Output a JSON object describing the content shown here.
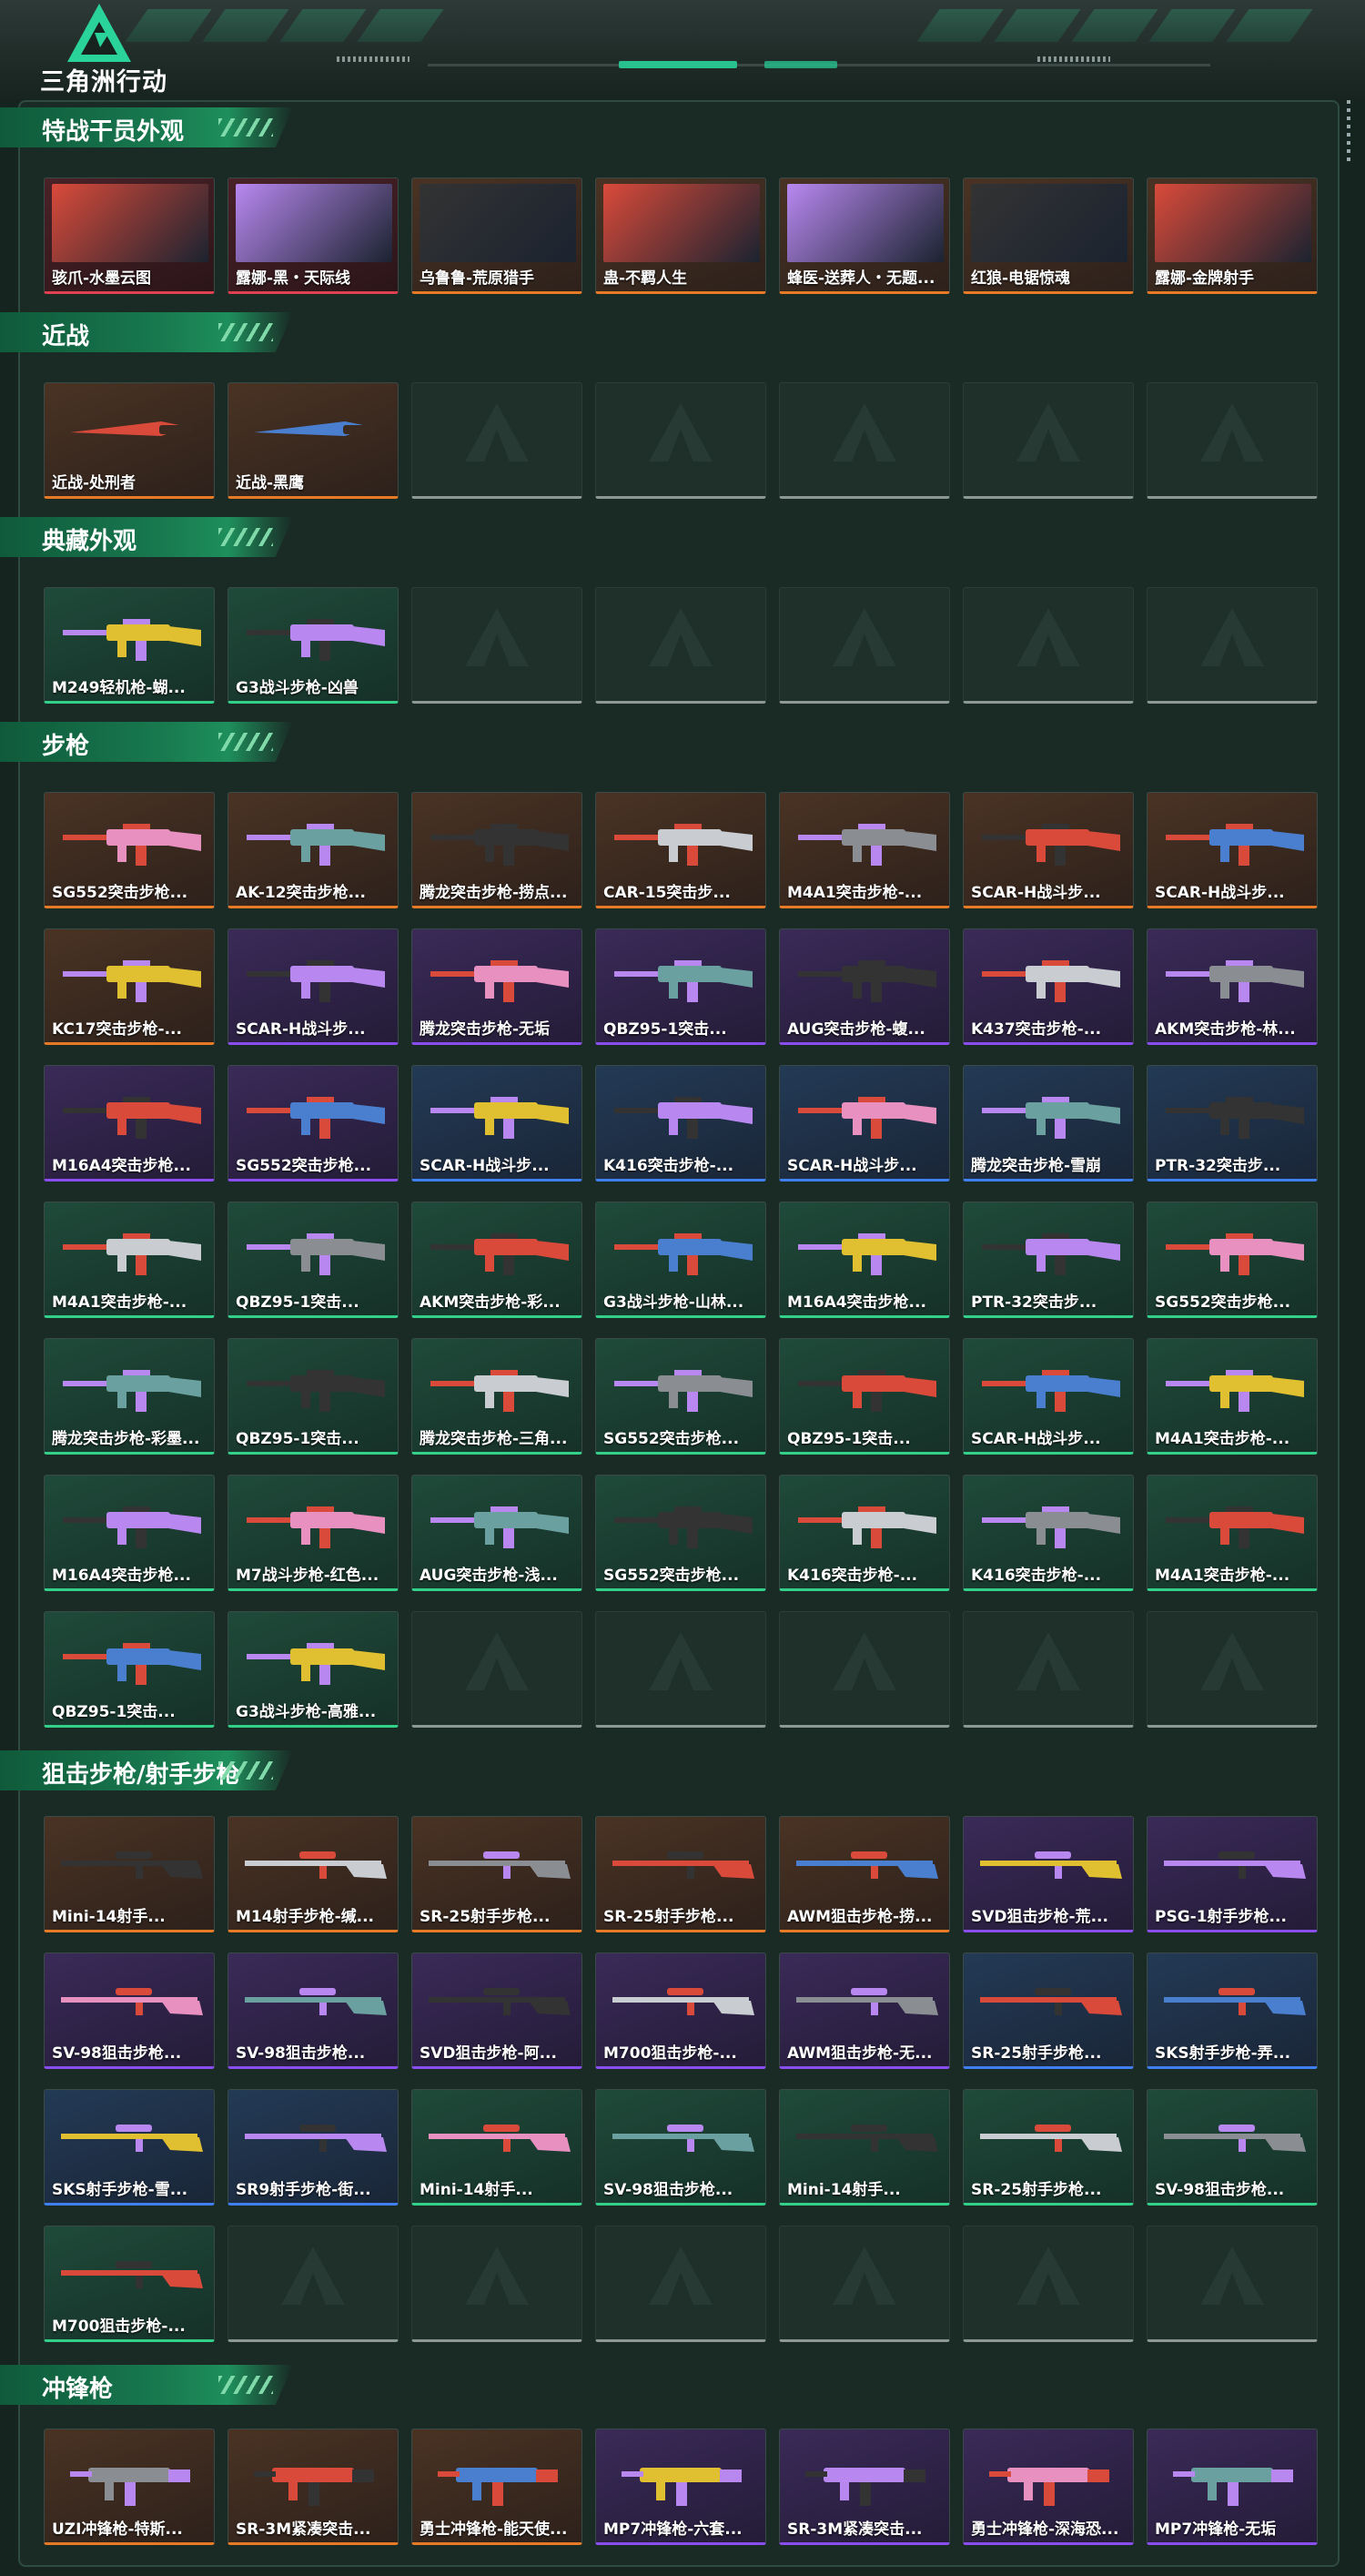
{
  "header": {
    "logo_text": "三角洲行动"
  },
  "colors": {
    "gold": "#e77a24",
    "purple": "#8a4ef0",
    "blue": "#3f7ff0",
    "green": "#33d08a",
    "red": "#e04150",
    "accent": "#27c08e"
  },
  "sections": [
    {
      "title": "特战干员外观",
      "items": [
        {
          "label": "骇爪-水墨云图",
          "rarity": "red",
          "icon": "operator-portrait"
        },
        {
          "label": "露娜-黑・天际线",
          "rarity": "red",
          "icon": "operator-portrait"
        },
        {
          "label": "乌鲁鲁-荒原猎手",
          "rarity": "gold",
          "icon": "operator-portrait"
        },
        {
          "label": "蛊-不羁人生",
          "rarity": "gold",
          "icon": "operator-portrait"
        },
        {
          "label": "蜂医-送葬人・无题...",
          "rarity": "gold",
          "icon": "operator-portrait"
        },
        {
          "label": "红狼-电锯惊魂",
          "rarity": "gold",
          "icon": "operator-portrait"
        },
        {
          "label": "露娜-金牌射手",
          "rarity": "gold",
          "icon": "operator-portrait"
        }
      ]
    },
    {
      "title": "近战",
      "items": [
        {
          "label": "近战-处刑者",
          "rarity": "gold",
          "icon": "blade"
        },
        {
          "label": "近战-黑鹰",
          "rarity": "gold",
          "icon": "knife"
        },
        {
          "empty": true
        },
        {
          "empty": true
        },
        {
          "empty": true
        },
        {
          "empty": true
        },
        {
          "empty": true
        }
      ]
    },
    {
      "title": "典藏外观",
      "items": [
        {
          "label": "M249轻机枪-蝴...",
          "rarity": "green",
          "icon": "lmg"
        },
        {
          "label": "G3战斗步枪-凶兽",
          "rarity": "green",
          "icon": "rifle"
        },
        {
          "empty": true
        },
        {
          "empty": true
        },
        {
          "empty": true
        },
        {
          "empty": true
        },
        {
          "empty": true
        }
      ]
    },
    {
      "title": "步枪",
      "items": [
        {
          "label": "SG552突击步枪...",
          "rarity": "gold",
          "icon": "rifle"
        },
        {
          "label": "AK-12突击步枪...",
          "rarity": "gold",
          "icon": "rifle"
        },
        {
          "label": "腾龙突击步枪-捞点...",
          "rarity": "gold",
          "icon": "rifle"
        },
        {
          "label": "CAR-15突击步...",
          "rarity": "gold",
          "icon": "rifle"
        },
        {
          "label": "M4A1突击步枪-...",
          "rarity": "gold",
          "icon": "rifle"
        },
        {
          "label": "SCAR-H战斗步...",
          "rarity": "gold",
          "icon": "rifle"
        },
        {
          "label": "SCAR-H战斗步...",
          "rarity": "gold",
          "icon": "rifle"
        },
        {
          "label": "KC17突击步枪-...",
          "rarity": "gold",
          "icon": "rifle"
        },
        {
          "label": "SCAR-H战斗步...",
          "rarity": "purple",
          "icon": "rifle"
        },
        {
          "label": "腾龙突击步枪-无垢",
          "rarity": "purple",
          "icon": "rifle"
        },
        {
          "label": "QBZ95-1突击...",
          "rarity": "purple",
          "icon": "rifle"
        },
        {
          "label": "AUG突击步枪-蝮...",
          "rarity": "purple",
          "icon": "rifle"
        },
        {
          "label": "K437突击步枪-...",
          "rarity": "purple",
          "icon": "rifle"
        },
        {
          "label": "AKM突击步枪-林...",
          "rarity": "purple",
          "icon": "rifle"
        },
        {
          "label": "M16A4突击步枪...",
          "rarity": "purple",
          "icon": "rifle"
        },
        {
          "label": "SG552突击步枪...",
          "rarity": "purple",
          "icon": "rifle"
        },
        {
          "label": "SCAR-H战斗步...",
          "rarity": "blue",
          "icon": "rifle"
        },
        {
          "label": "K416突击步枪-...",
          "rarity": "blue",
          "icon": "rifle"
        },
        {
          "label": "SCAR-H战斗步...",
          "rarity": "blue",
          "icon": "rifle"
        },
        {
          "label": "腾龙突击步枪-雪崩",
          "rarity": "blue",
          "icon": "rifle"
        },
        {
          "label": "PTR-32突击步...",
          "rarity": "blue",
          "icon": "rifle"
        },
        {
          "label": "M4A1突击步枪-...",
          "rarity": "green",
          "icon": "rifle"
        },
        {
          "label": "QBZ95-1突击...",
          "rarity": "green",
          "icon": "rifle"
        },
        {
          "label": "AKM突击步枪-彩...",
          "rarity": "green",
          "icon": "rifle"
        },
        {
          "label": "G3战斗步枪-山林...",
          "rarity": "green",
          "icon": "rifle"
        },
        {
          "label": "M16A4突击步枪...",
          "rarity": "green",
          "icon": "rifle"
        },
        {
          "label": "PTR-32突击步...",
          "rarity": "green",
          "icon": "rifle"
        },
        {
          "label": "SG552突击步枪...",
          "rarity": "green",
          "icon": "rifle"
        },
        {
          "label": "腾龙突击步枪-彩墨...",
          "rarity": "green",
          "icon": "rifle"
        },
        {
          "label": "QBZ95-1突击...",
          "rarity": "green",
          "icon": "rifle"
        },
        {
          "label": "腾龙突击步枪-三角...",
          "rarity": "green",
          "icon": "rifle"
        },
        {
          "label": "SG552突击步枪...",
          "rarity": "green",
          "icon": "rifle"
        },
        {
          "label": "QBZ95-1突击...",
          "rarity": "green",
          "icon": "rifle"
        },
        {
          "label": "SCAR-H战斗步...",
          "rarity": "green",
          "icon": "rifle"
        },
        {
          "label": "M4A1突击步枪-...",
          "rarity": "green",
          "icon": "rifle"
        },
        {
          "label": "M16A4突击步枪...",
          "rarity": "green",
          "icon": "rifle"
        },
        {
          "label": "M7战斗步枪-红色...",
          "rarity": "green",
          "icon": "rifle"
        },
        {
          "label": "AUG突击步枪-浅...",
          "rarity": "green",
          "icon": "rifle"
        },
        {
          "label": "SG552突击步枪...",
          "rarity": "green",
          "icon": "rifle"
        },
        {
          "label": "K416突击步枪-...",
          "rarity": "green",
          "icon": "rifle"
        },
        {
          "label": "K416突击步枪-...",
          "rarity": "green",
          "icon": "rifle"
        },
        {
          "label": "M4A1突击步枪-...",
          "rarity": "green",
          "icon": "rifle"
        },
        {
          "label": "QBZ95-1突击...",
          "rarity": "green",
          "icon": "rifle"
        },
        {
          "label": "G3战斗步枪-高雅...",
          "rarity": "green",
          "icon": "rifle"
        },
        {
          "empty": true
        },
        {
          "empty": true
        },
        {
          "empty": true
        },
        {
          "empty": true
        },
        {
          "empty": true
        }
      ]
    },
    {
      "title": "狙击步枪/射手步枪",
      "items": [
        {
          "label": "Mini-14射手...",
          "rarity": "gold",
          "icon": "sniper"
        },
        {
          "label": "M14射手步枪-缄...",
          "rarity": "gold",
          "icon": "sniper"
        },
        {
          "label": "SR-25射手步枪...",
          "rarity": "gold",
          "icon": "sniper"
        },
        {
          "label": "SR-25射手步枪...",
          "rarity": "gold",
          "icon": "sniper"
        },
        {
          "label": "AWM狙击步枪-捞...",
          "rarity": "gold",
          "icon": "sniper"
        },
        {
          "label": "SVD狙击步枪-荒...",
          "rarity": "purple",
          "icon": "sniper"
        },
        {
          "label": "PSG-1射手步枪...",
          "rarity": "purple",
          "icon": "sniper"
        },
        {
          "label": "SV-98狙击步枪...",
          "rarity": "purple",
          "icon": "sniper"
        },
        {
          "label": "SV-98狙击步枪...",
          "rarity": "purple",
          "icon": "sniper"
        },
        {
          "label": "SVD狙击步枪-阿...",
          "rarity": "purple",
          "icon": "sniper"
        },
        {
          "label": "M700狙击步枪-...",
          "rarity": "purple",
          "icon": "sniper"
        },
        {
          "label": "AWM狙击步枪-无...",
          "rarity": "purple",
          "icon": "sniper"
        },
        {
          "label": "SR-25射手步枪...",
          "rarity": "blue",
          "icon": "sniper"
        },
        {
          "label": "SKS射手步枪-弄...",
          "rarity": "blue",
          "icon": "sniper"
        },
        {
          "label": "SKS射手步枪-雪...",
          "rarity": "blue",
          "icon": "sniper"
        },
        {
          "label": "SR9射手步枪-街...",
          "rarity": "blue",
          "icon": "sniper"
        },
        {
          "label": "Mini-14射手...",
          "rarity": "green",
          "icon": "sniper"
        },
        {
          "label": "SV-98狙击步枪...",
          "rarity": "green",
          "icon": "sniper"
        },
        {
          "label": "Mini-14射手...",
          "rarity": "green",
          "icon": "sniper"
        },
        {
          "label": "SR-25射手步枪...",
          "rarity": "green",
          "icon": "sniper"
        },
        {
          "label": "SV-98狙击步枪...",
          "rarity": "green",
          "icon": "sniper"
        },
        {
          "label": "M700狙击步枪-...",
          "rarity": "green",
          "icon": "sniper"
        },
        {
          "empty": true
        },
        {
          "empty": true
        },
        {
          "empty": true
        },
        {
          "empty": true
        },
        {
          "empty": true
        },
        {
          "empty": true
        }
      ]
    },
    {
      "title": "冲锋枪",
      "items": [
        {
          "label": "UZI冲锋枪-特斯...",
          "rarity": "gold",
          "icon": "smg"
        },
        {
          "label": "SR-3M紧凑突击...",
          "rarity": "gold",
          "icon": "smg"
        },
        {
          "label": "勇士冲锋枪-能天使...",
          "rarity": "gold",
          "icon": "smg"
        },
        {
          "label": "MP7冲锋枪-六套...",
          "rarity": "purple",
          "icon": "smg"
        },
        {
          "label": "SR-3M紧凑突击...",
          "rarity": "purple",
          "icon": "smg"
        },
        {
          "label": "勇士冲锋枪-深海恐...",
          "rarity": "purple",
          "icon": "smg"
        },
        {
          "label": "MP7冲锋枪-无垢",
          "rarity": "purple",
          "icon": "smg"
        }
      ]
    }
  ]
}
